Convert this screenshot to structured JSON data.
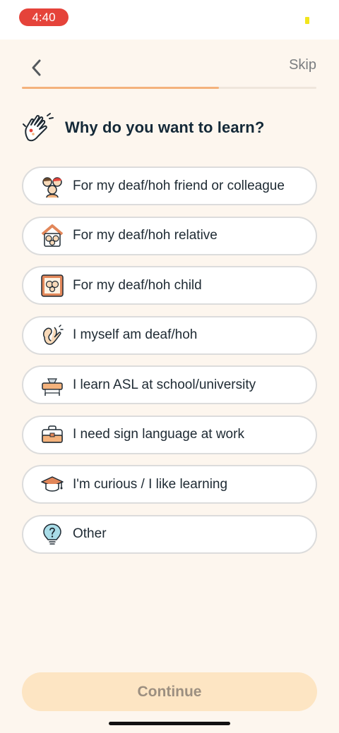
{
  "status_bar": {
    "time": "4:40"
  },
  "nav": {
    "skip_label": "Skip",
    "progress": 0.67
  },
  "question": {
    "title": "Why do you want to learn?",
    "icon": "waving-hand-icon"
  },
  "options": [
    {
      "label": "For my deaf/hoh friend or colleague",
      "icon": "friends-group-icon"
    },
    {
      "label": "For my deaf/hoh relative",
      "icon": "family-house-icon"
    },
    {
      "label": "For my deaf/hoh child",
      "icon": "child-photo-frame-icon"
    },
    {
      "label": "I myself am deaf/hoh",
      "icon": "ear-hand-icon"
    },
    {
      "label": "I learn ASL at school/university",
      "icon": "school-desk-icon"
    },
    {
      "label": "I need sign language at work",
      "icon": "briefcase-icon"
    },
    {
      "label": "I'm curious / I like learning",
      "icon": "graduation-cap-icon"
    },
    {
      "label": "Other",
      "icon": "question-bulb-icon"
    }
  ],
  "footer": {
    "continue_label": "Continue"
  },
  "colors": {
    "accent": "#f4b27c",
    "background": "#fdf6ee",
    "continue_bg": "#fde5c3",
    "time_pill": "#e5433a"
  }
}
